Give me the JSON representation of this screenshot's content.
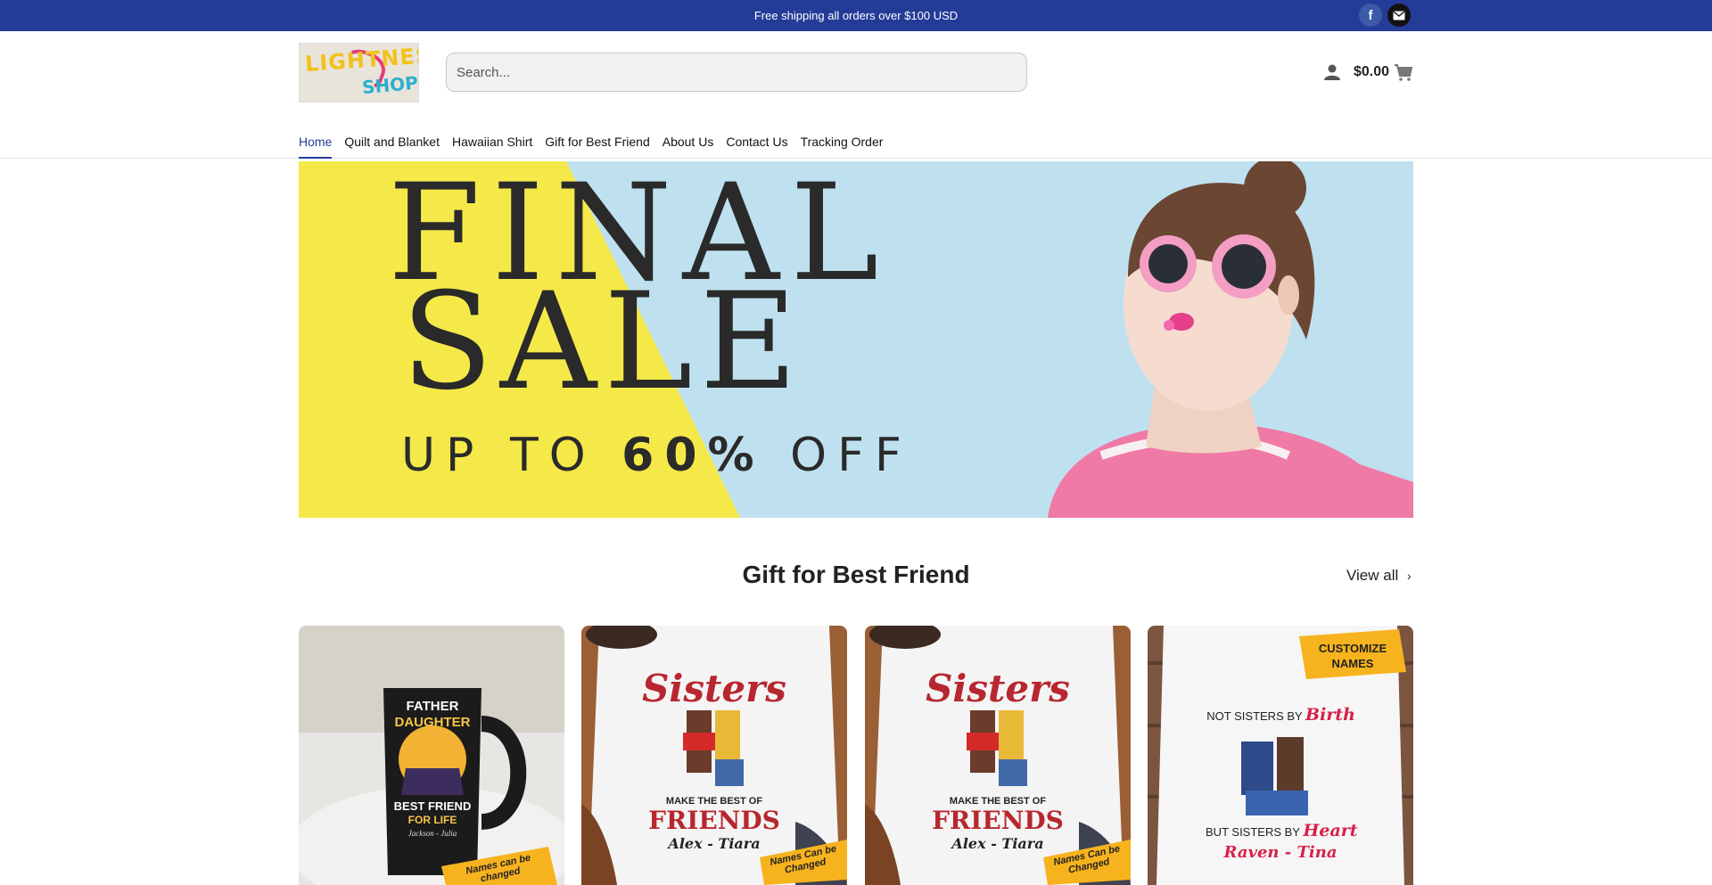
{
  "topbar": {
    "shipping_text": "Free shipping all orders over $100 USD",
    "social": [
      {
        "name": "facebook-icon",
        "glyph": "f"
      },
      {
        "name": "mail-icon",
        "glyph": "✉"
      }
    ]
  },
  "header": {
    "logo_top": "LIGHTNES",
    "logo_bottom": "SHOP!",
    "search_placeholder": "Search...",
    "cart_total": "$0.00"
  },
  "nav": [
    {
      "label": "Home",
      "active": true
    },
    {
      "label": "Quilt and Blanket"
    },
    {
      "label": "Hawaiian Shirt"
    },
    {
      "label": "Gift for Best Friend"
    },
    {
      "label": "About Us"
    },
    {
      "label": "Contact Us"
    },
    {
      "label": "Tracking Order"
    }
  ],
  "hero": {
    "line1": "FINAL",
    "line2": "SALE",
    "line3_prefix": "UP TO ",
    "line3_bold": "60%",
    "line3_suffix": " OFF"
  },
  "section": {
    "title": "Gift for Best Friend",
    "view_all": "View all"
  },
  "products": [
    {
      "kind": "mug",
      "lines": [
        "FATHER",
        "DAUGHTER",
        "BEST FRIEND",
        "FOR LIFE",
        "Jackson - Julia"
      ],
      "badge": "Names can be changed"
    },
    {
      "kind": "shirt",
      "lines": [
        "Sisters",
        "MAKE THE BEST OF",
        "FRIENDS",
        "Alex - Tiara"
      ],
      "badge": "Names Can be Changed"
    },
    {
      "kind": "shirt",
      "lines": [
        "Sisters",
        "MAKE THE BEST OF",
        "FRIENDS",
        "Alex - Tiara"
      ],
      "badge": "Names Can be Changed"
    },
    {
      "kind": "shirt2",
      "lines": [
        "CUSTOMIZE",
        "NAMES",
        "NOT SISTERS BY",
        "Birth",
        "BUT SISTERS BY",
        "Heart",
        "Raven - Tina"
      ],
      "badge": ""
    }
  ],
  "colors": {
    "topbar": "#243c97",
    "accent": "#243c97",
    "hero_yellow": "#f5e94a",
    "hero_blue": "#bfe1ef",
    "shirt_red": "#b8272f"
  }
}
